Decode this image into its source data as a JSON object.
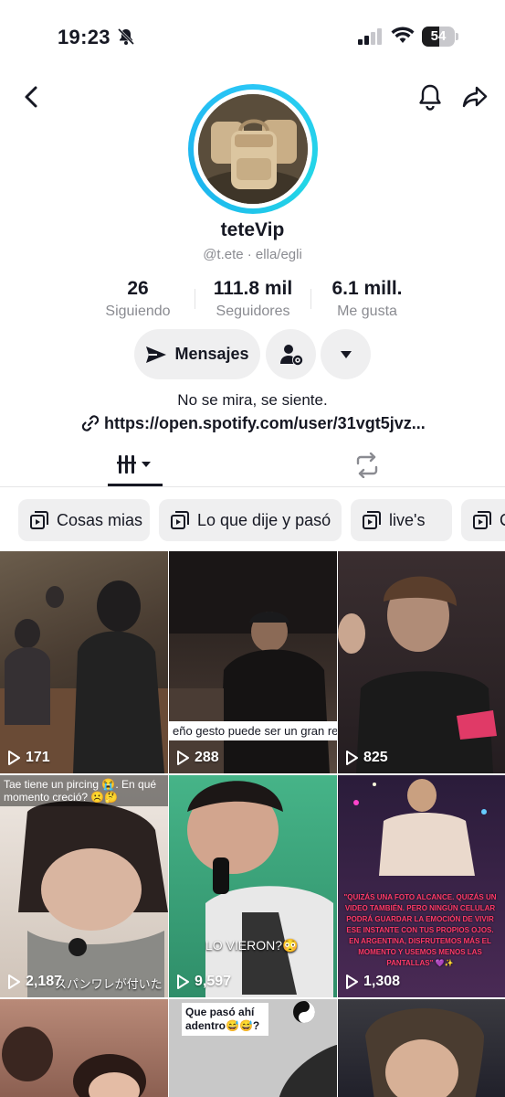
{
  "status_bar": {
    "time": "19:23",
    "battery": "54",
    "battery_level": 54
  },
  "profile": {
    "username": "teteVip",
    "handle": "@t.ete · ella/egli",
    "stats": [
      {
        "value": "26",
        "label": "Siguiendo"
      },
      {
        "value": "111.8 mil",
        "label": "Seguidores"
      },
      {
        "value": "6.1 mill.",
        "label": "Me gusta"
      }
    ],
    "message_label": "Mensajes",
    "bio": "No se mira, se siente.",
    "link": "https://open.spotify.com/user/31vgt5jvz..."
  },
  "playlists": [
    "Cosas mias",
    "Lo que dije y pasó",
    "live's",
    "C"
  ],
  "videos": [
    {
      "views": "171",
      "caption": "",
      "overlay": ""
    },
    {
      "views": "288",
      "caption": "eño gesto puede ser un gran resc",
      "overlay": ""
    },
    {
      "views": "825",
      "caption": "",
      "overlay": ""
    },
    {
      "views": "2,187",
      "caption": "Tae tiene un pircing 😭. En qué momento creció? ☹️🤔",
      "overlay": "スパンワレが付いた"
    },
    {
      "views": "9,597",
      "caption": "",
      "overlay": "LO VIERON?😳"
    },
    {
      "views": "1,308",
      "caption": "",
      "overlay": "\"QUIZÁS UNA FOTO ALCANCE. QUIZÁS UN VIDEO TAMBIÉN. PERO NINGÚN CELULAR PODRÁ GUARDAR LA EMOCIÓN DE VIVIR ESE INSTANTE CON TUS PROPIOS OJOS. EN ARGENTINA, DISFRUTEMOS MÁS EL MOMENTO Y USEMOS MENOS LAS PANTALLAS\" 💜✨"
    },
    {
      "views": "",
      "caption": "",
      "overlay": ""
    },
    {
      "views": "",
      "caption": "Que pasó ahí adentro😅😅?",
      "overlay": ""
    },
    {
      "views": "",
      "caption": "",
      "overlay": ""
    }
  ],
  "colors": {
    "ring": "#2ac6f6",
    "text": "#161823",
    "muted": "#8a8b91",
    "button_bg": "#efeff0"
  }
}
